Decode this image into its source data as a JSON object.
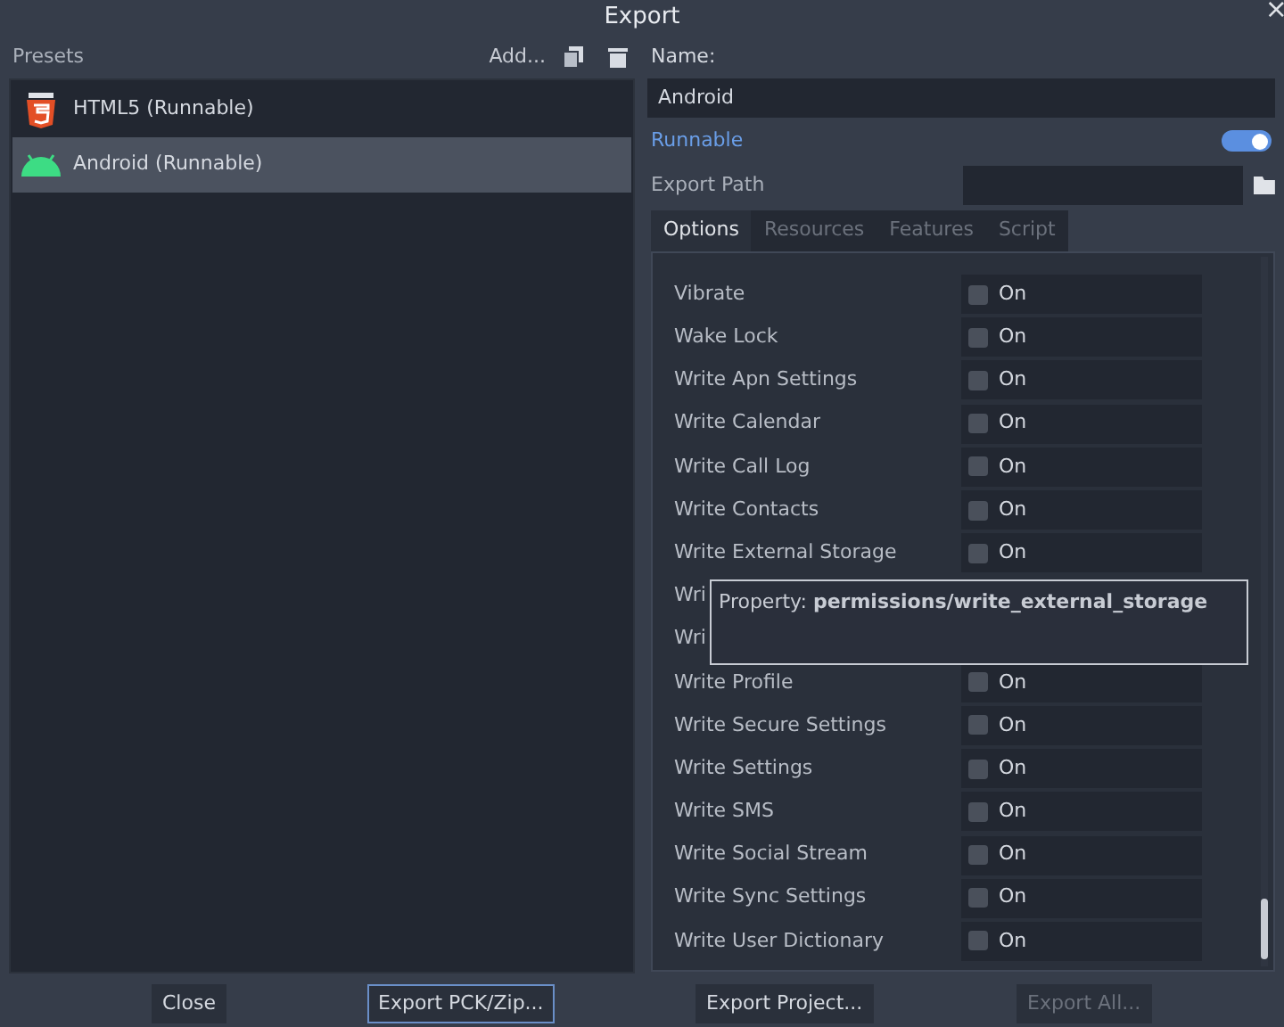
{
  "window": {
    "title": "Export",
    "close": "×"
  },
  "presets": {
    "label": "Presets",
    "add": "Add...",
    "items": [
      {
        "name": "HTML5 (Runnable)",
        "kind": "html5",
        "selected": false
      },
      {
        "name": "Android (Runnable)",
        "kind": "android",
        "selected": true
      }
    ]
  },
  "name": {
    "label": "Name:",
    "value": "Android"
  },
  "runnable": {
    "label": "Runnable",
    "on": true
  },
  "export_path": {
    "label": "Export Path"
  },
  "tabs": [
    {
      "label": "Options",
      "selected": true
    },
    {
      "label": "Resources",
      "selected": false
    },
    {
      "label": "Features",
      "selected": false
    },
    {
      "label": "Script",
      "selected": false
    }
  ],
  "options": [
    {
      "label": "Vibrate",
      "checked": false,
      "value": "On"
    },
    {
      "label": "Wake Lock",
      "checked": false,
      "value": "On"
    },
    {
      "label": "Write Apn Settings",
      "checked": false,
      "value": "On"
    },
    {
      "label": "Write Calendar",
      "checked": false,
      "value": "On"
    },
    {
      "label": "Write Call Log",
      "checked": false,
      "value": "On"
    },
    {
      "label": "Write Contacts",
      "checked": false,
      "value": "On"
    },
    {
      "label": "Write External Storage",
      "checked": false,
      "value": "On"
    },
    {
      "label": "Wri"
    },
    {
      "label": "Wri"
    },
    {
      "label": "Write Profile",
      "checked": false,
      "value": "On"
    },
    {
      "label": "Write Secure Settings",
      "checked": false,
      "value": "On"
    },
    {
      "label": "Write Settings",
      "checked": false,
      "value": "On"
    },
    {
      "label": "Write SMS",
      "checked": false,
      "value": "On"
    },
    {
      "label": "Write Social Stream",
      "checked": false,
      "value": "On"
    },
    {
      "label": "Write Sync Settings",
      "checked": false,
      "value": "On"
    },
    {
      "label": "Write User Dictionary",
      "checked": false,
      "value": "On"
    }
  ],
  "tooltip": "Property: **permissions/write_external_storage**",
  "buttons": [
    {
      "label": "Close",
      "focused": false,
      "disabled": false
    },
    {
      "label": "Export PCK/Zip...",
      "focused": true,
      "disabled": false
    },
    {
      "label": "Export Project...",
      "focused": false,
      "disabled": false
    },
    {
      "label": "Export All...",
      "focused": false,
      "disabled": true
    }
  ]
}
